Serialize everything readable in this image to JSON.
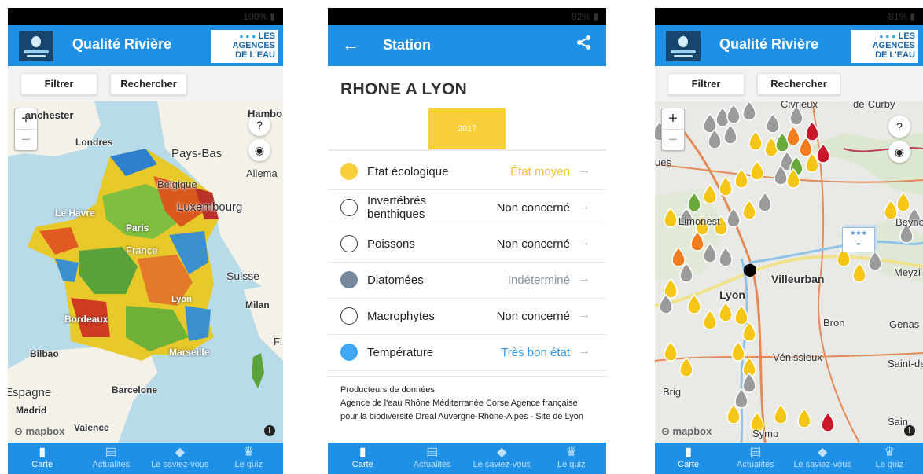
{
  "screen1": {
    "status": "100%",
    "app_title": "Qualité Rivière",
    "logo_right": {
      "line1": "LES",
      "line2": "AGENCES",
      "line3": "DE L'EAU"
    },
    "buttons": {
      "filter": "Filtrer",
      "search": "Rechercher"
    },
    "zoom": {
      "in": "+",
      "out": "−"
    },
    "map_labels": [
      "anchester",
      "Hambo",
      "Pays-Bas",
      "Londres",
      "Allema",
      "Belgique",
      "Luxembourg",
      "Le Havre",
      "Paris",
      "France",
      "Suisse",
      "Milan",
      "Lyon",
      "Bordeaux",
      "Fl",
      "Bilbao",
      "Marseille",
      "Espagne",
      "Barcelone",
      "Madrid",
      "Valence"
    ],
    "attribution": "mapbox"
  },
  "screen2": {
    "status": "92%",
    "header_title": "Station",
    "back_icon": "arrow-left-icon",
    "share_icon": "share-icon",
    "station_name": "RHONE A LYON",
    "year": "2017",
    "rows": [
      {
        "label": "Etat écologique",
        "value": "État moyen",
        "color": "#f9cf3b",
        "value_color": "#f4c22f",
        "filled": true
      },
      {
        "label": "Invertébrés benthiques",
        "value": "Non concerné",
        "color": "#333333",
        "value_color": "#222222",
        "filled": false
      },
      {
        "label": "Poissons",
        "value": "Non concerné",
        "color": "#333333",
        "value_color": "#222222",
        "filled": false
      },
      {
        "label": "Diatomées",
        "value": "Indéterminé",
        "color": "#77879b",
        "value_color": "#8896a8",
        "filled": true
      },
      {
        "label": "Macrophytes",
        "value": "Non concerné",
        "color": "#333333",
        "value_color": "#222222",
        "filled": false
      },
      {
        "label": "Température",
        "value": "Très bon état",
        "color": "#3fa9f5",
        "value_color": "#2f9be8",
        "filled": true
      }
    ],
    "producers_title": "Producteurs de données",
    "producers_text": "Agence de l'eau Rhône Méditerranée Corse    Agence française pour la biodiversité    Dreal Auvergne-Rhône-Alpes - Site de Lyon"
  },
  "screen3": {
    "status": "81%",
    "map_labels": [
      "Limonest",
      "Beyno",
      "Villeurban",
      "Lyon",
      "Meyzi",
      "Bron",
      "Genas",
      "Vénissieux",
      "Saint-de",
      "Brig",
      "Sain",
      "Symp",
      "ues",
      "Civrieux",
      "de-Curby"
    ],
    "attribution": "mapbox"
  },
  "nav": [
    {
      "label": "Carte",
      "icon": "map-icon"
    },
    {
      "label": "Actualités",
      "icon": "news-icon"
    },
    {
      "label": "Le saviez-vous",
      "icon": "graduation-cap-icon"
    },
    {
      "label": "Le quiz",
      "icon": "trophy-icon"
    }
  ],
  "colors": {
    "app_blue": "#1e90e6",
    "marker_grey": "#9b9b9b",
    "marker_yellow": "#f5c518",
    "marker_orange": "#f27d1e",
    "marker_green": "#6aaa3a",
    "marker_red": "#c8182a"
  }
}
